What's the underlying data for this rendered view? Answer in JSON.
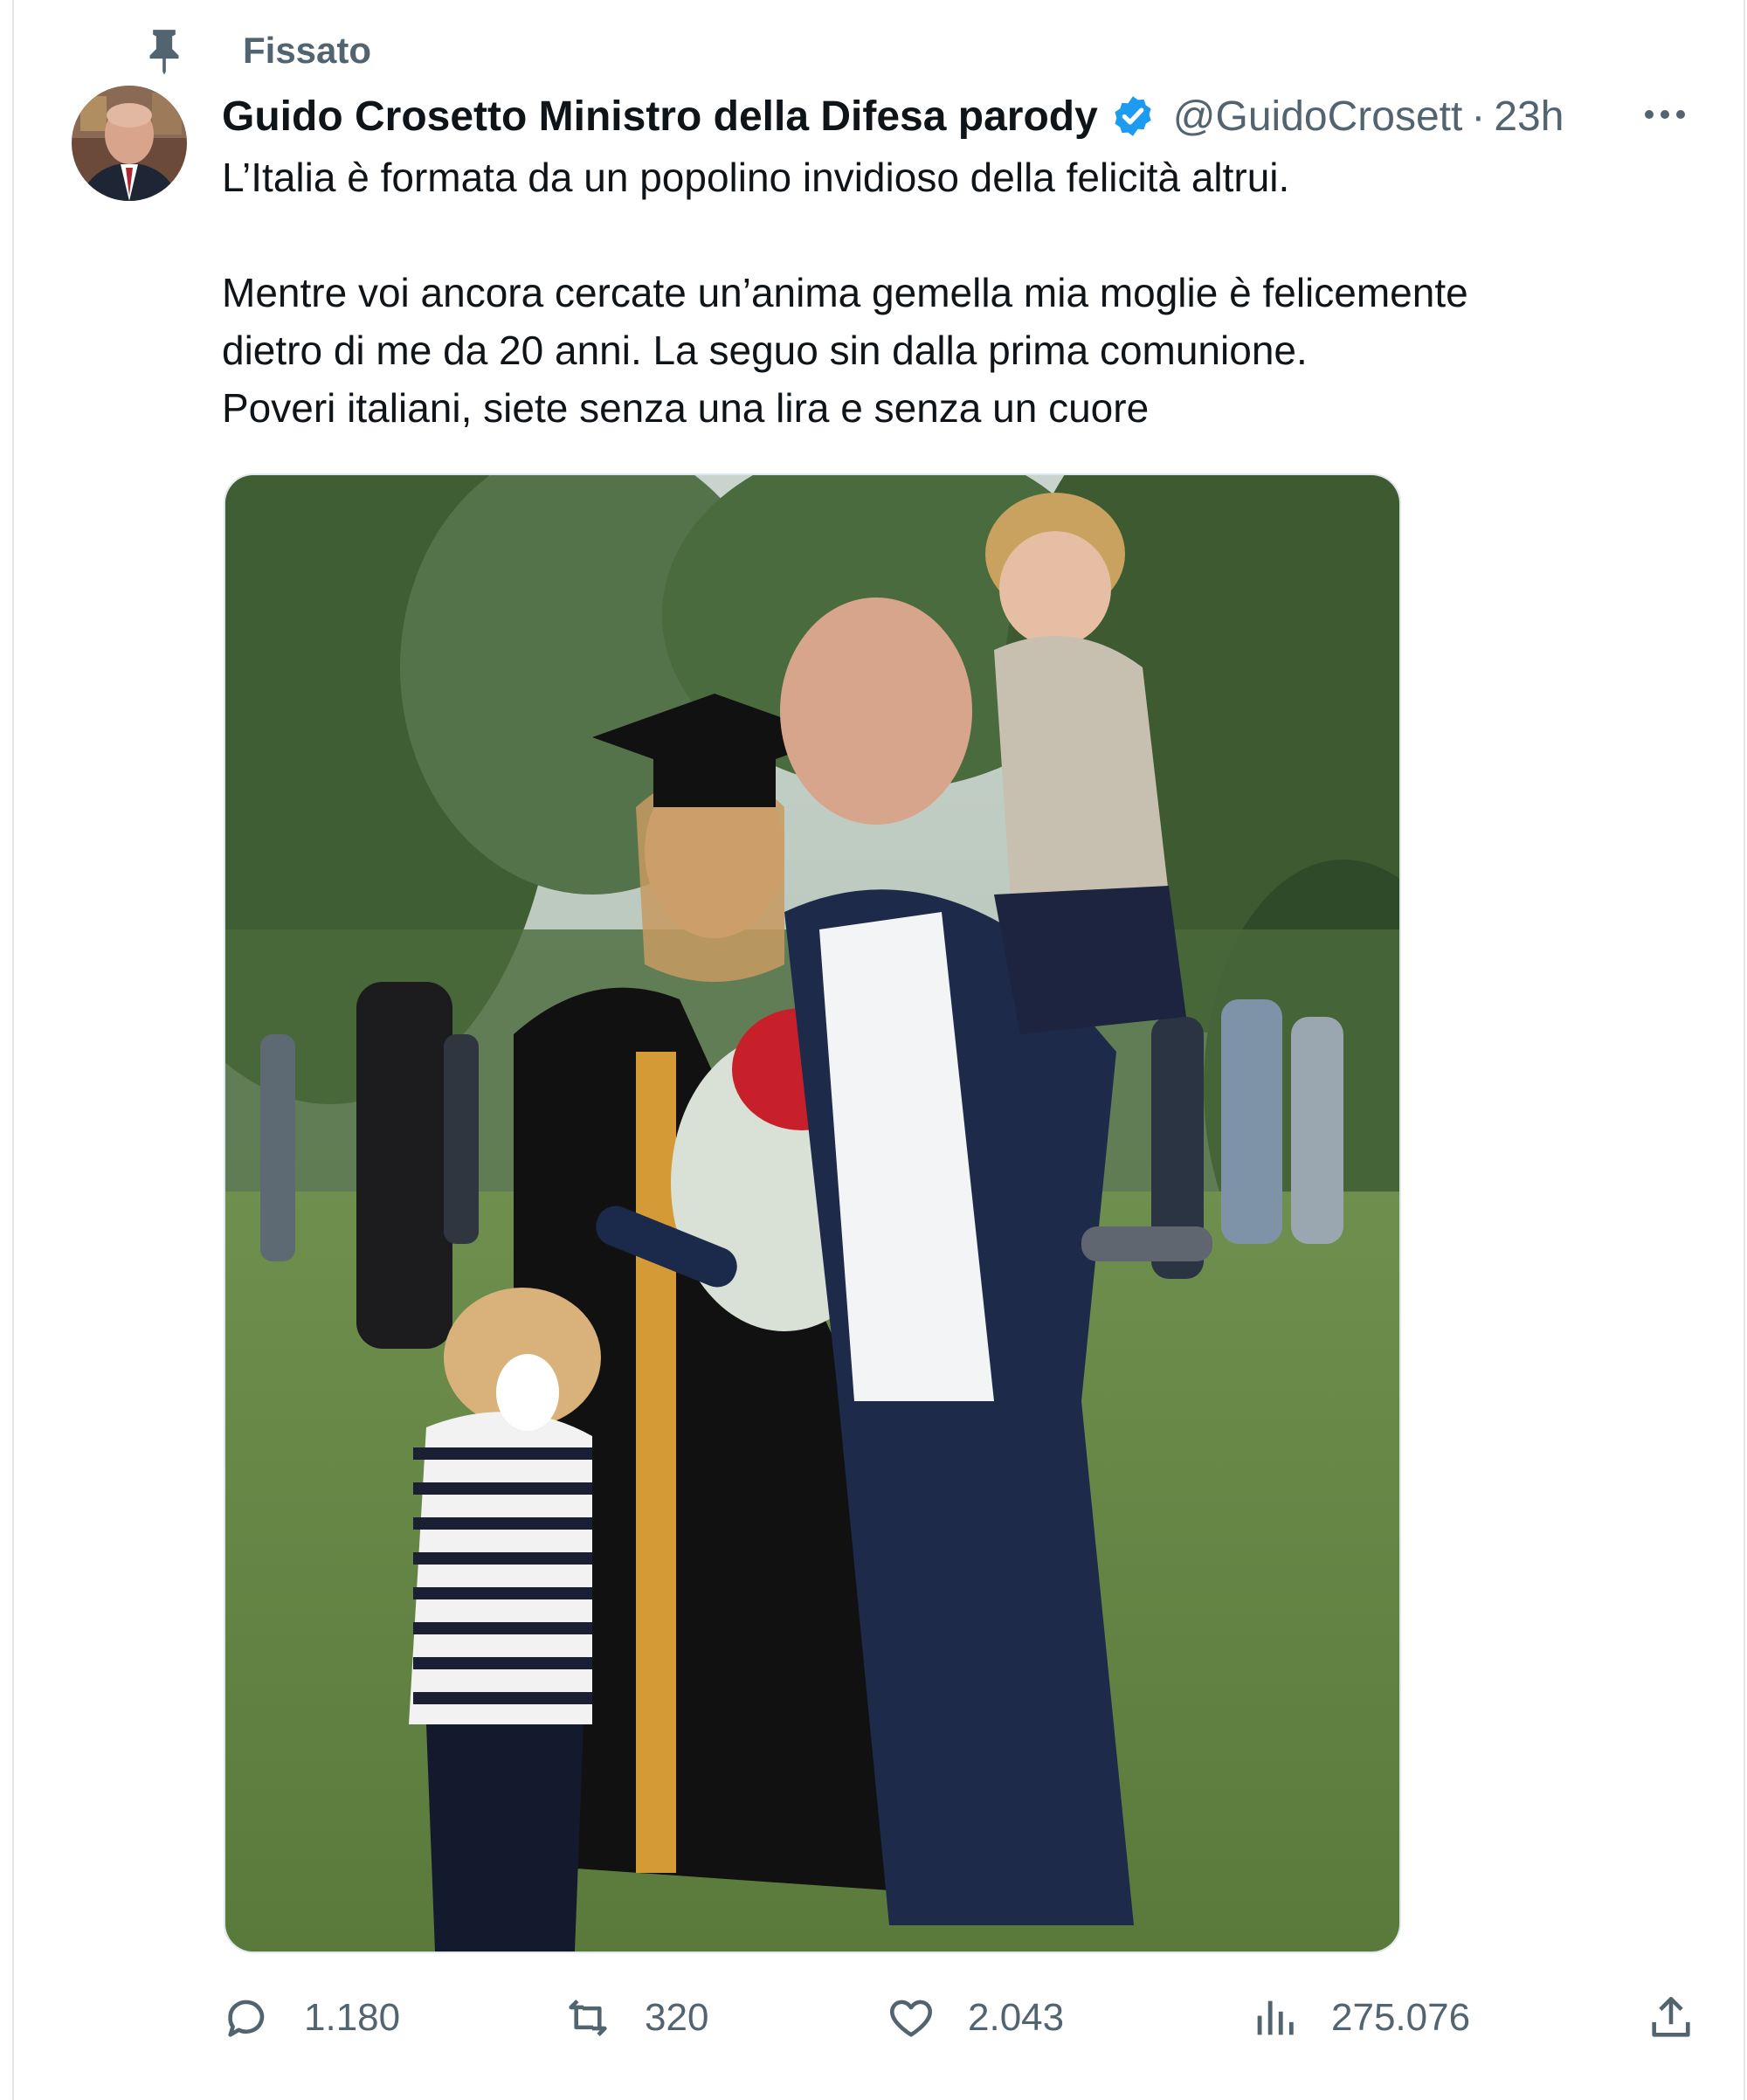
{
  "tweet": {
    "pinned_label": "Fissato",
    "author": {
      "display_name": "Guido Crosetto Ministro della Difesa parody",
      "handle": "@GuidoCrosett",
      "verified": true
    },
    "separator": "·",
    "time": "23h",
    "text": {
      "p1": "L’Italia è formata da un popolino invidioso della felicità altrui.",
      "p2": "Mentre voi ancora cercate un’anima gemella mia moglie è felicemente\ndietro di me da 20 anni. La seguo sin dalla prima comunione.\nPoveri italiani, siete senza una lira e senza un cuore"
    },
    "stats": {
      "replies": "1.180",
      "reposts": "320",
      "likes": "2.043",
      "views": "275.076"
    }
  },
  "icons": {
    "pin": "pin-icon",
    "verified": "verified-badge-icon",
    "more": "more-options-icon",
    "reply": "reply-icon",
    "repost": "repost-icon",
    "like": "heart-icon",
    "views": "views-chart-icon",
    "share": "share-icon"
  },
  "colors": {
    "verified_blue": "#1d9bf0",
    "secondary_text": "#536471",
    "primary_text": "#0f1419"
  }
}
